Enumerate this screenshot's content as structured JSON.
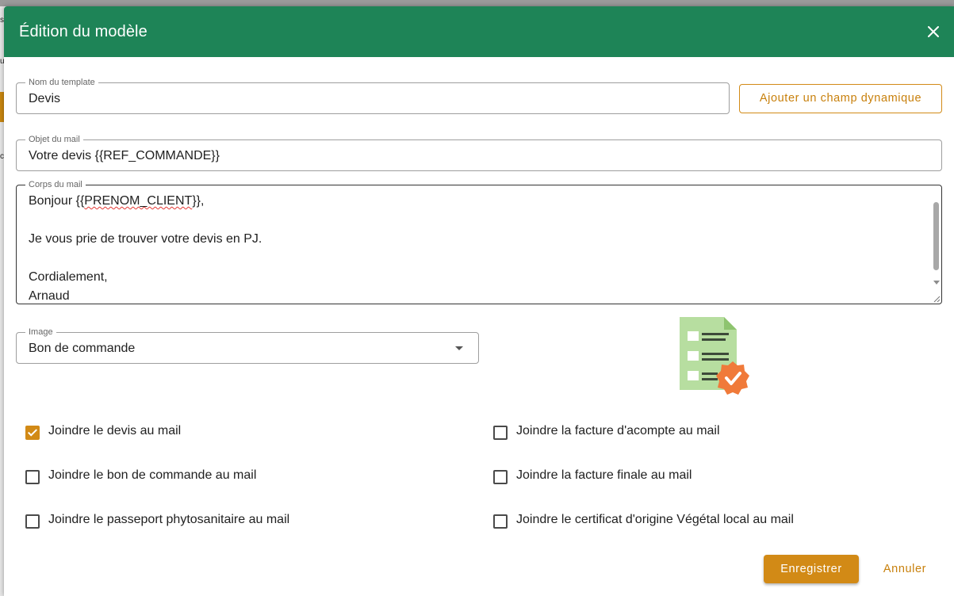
{
  "background": {
    "fragments": [
      "s",
      "u",
      "c"
    ]
  },
  "dialog": {
    "title": "Édition du modèle",
    "close_icon": "close-icon",
    "header_color": "#1e8457"
  },
  "template_name": {
    "label": "Nom du template",
    "value": "Devis"
  },
  "add_dynamic_field_label": "Ajouter un champ dynamique",
  "subject": {
    "label": "Objet du mail",
    "value": "Votre devis {{REF_COMMANDE}}"
  },
  "body": {
    "label": "Corps du mail",
    "line1_prefix": "Bonjour {{",
    "line1_token": "PRENOM_CLIENT",
    "line1_suffix": "}},",
    "line2": "",
    "line3": "Je vous prie de trouver votre devis en PJ.",
    "line4": "",
    "line5": "Cordialement,",
    "line6": "Arnaud"
  },
  "image_select": {
    "label": "Image",
    "value": "Bon de commande",
    "illustration_icon": "order-document-check-icon"
  },
  "checkboxes": {
    "attach_quote": {
      "label": "Joindre le devis au mail",
      "checked": true
    },
    "attach_deposit_invoice": {
      "label": "Joindre la facture d'acompte au mail",
      "checked": false
    },
    "attach_order_form": {
      "label": "Joindre le bon de commande au mail",
      "checked": false
    },
    "attach_final_invoice": {
      "label": "Joindre la facture finale au mail",
      "checked": false
    },
    "attach_phyto_passport": {
      "label": "Joindre le passeport phytosanitaire au mail",
      "checked": false
    },
    "attach_local_certificate": {
      "label": "Joindre le certificat d'origine Végétal local au mail",
      "checked": false
    }
  },
  "actions": {
    "save_label": "Enregistrer",
    "cancel_label": "Annuler"
  },
  "colors": {
    "accent": "#d28a16",
    "header": "#1e8457"
  }
}
